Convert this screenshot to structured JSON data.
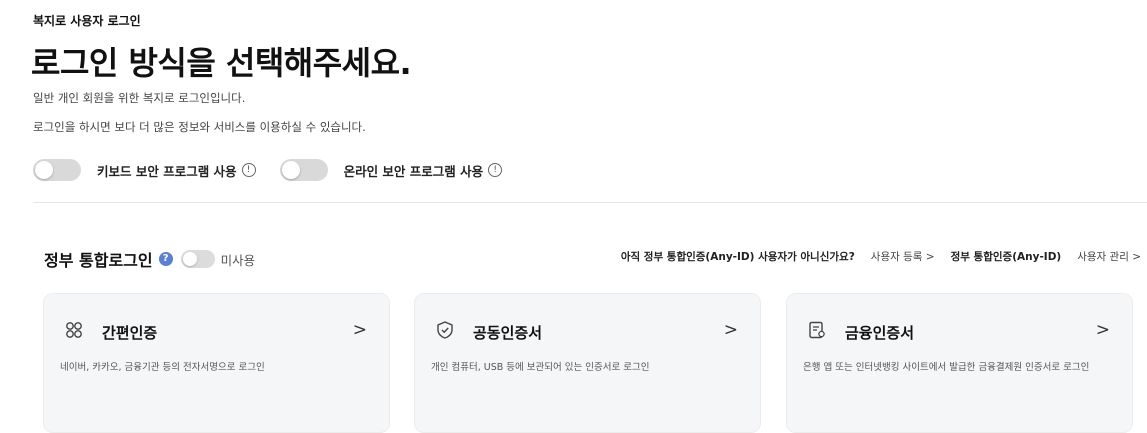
{
  "breadcrumb": "복지로 사용자 로그인",
  "page_title": "로그인 방식을 선택해주세요.",
  "description": [
    "일반 개인 회원을 위한 복지로 로그인입니다.",
    "로그인을 하시면 보다 더 많은 정보와 서비스를 이용하실 수 있습니다."
  ],
  "security_toggles": [
    {
      "label": "키보드 보안 프로그램 사용",
      "enabled": false,
      "info_icon": "info-circle-icon"
    },
    {
      "label": "온라인 보안 프로그램 사용",
      "enabled": false,
      "info_icon": "info-circle-icon"
    }
  ],
  "gov_login": {
    "title": "정부 통합로그인",
    "help_icon": "question-circle-icon",
    "toggle_label": "미사용",
    "enabled": false,
    "prompt": "아직 정부 통합인증(Any-ID) 사용자가 아니신가요?",
    "register_link": "사용자 등록 >",
    "service_name": "정부 통합인증(Any-ID)",
    "manage_link": "사용자 관리 >"
  },
  "cards": [
    {
      "icon": "simple-auth-icon",
      "title": "간편인증",
      "arrow": ">",
      "desc": "네이버, 카카오, 금융기관 등의 전자서명으로 로그인"
    },
    {
      "icon": "shield-check-icon",
      "title": "공동인증서",
      "arrow": ">",
      "desc": "개인 컴퓨터, USB 등에 보관되어 있는 인증서로 로그인"
    },
    {
      "icon": "financial-cert-icon",
      "title": "금융인증서",
      "arrow": ">",
      "desc": "은행 앱 또는 인터넷뱅킹 사이트에서 발급한 금융결제원 인증서로 로그인"
    }
  ],
  "colors": {
    "accent_help": "#5b7fd6",
    "card_bg": "#f5f6f8",
    "toggle_off": "#d9d9d9"
  }
}
